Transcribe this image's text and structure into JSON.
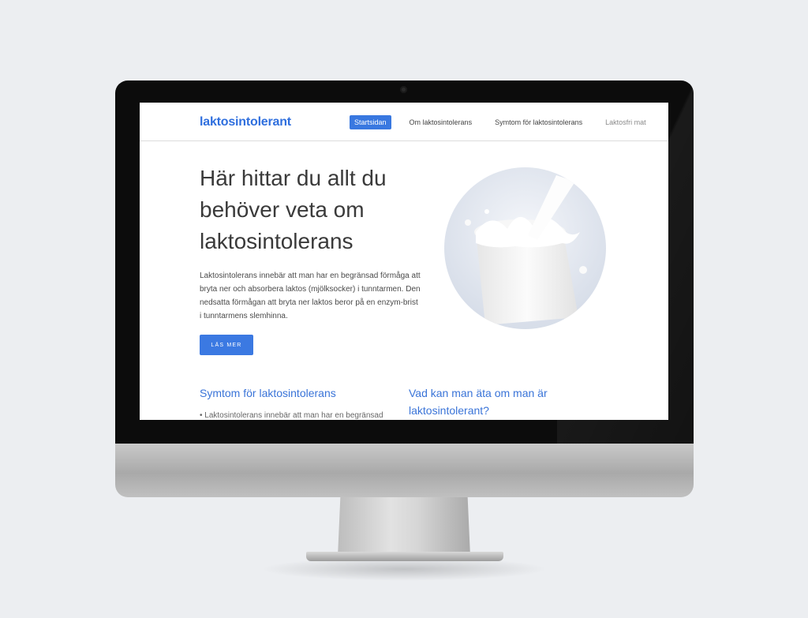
{
  "site": {
    "logo": "laktosintolerant"
  },
  "nav": [
    {
      "label": "Startsidan",
      "active": true
    },
    {
      "label": "Om laktosintolerans"
    },
    {
      "label": "Symtom för laktosintolerans"
    },
    {
      "label": "Laktosfri mat"
    }
  ],
  "hero": {
    "title": "Här hittar du allt du behöver veta om laktosintolerans",
    "text": "Laktosintolerans innebär att man har en begränsad förmåga att bryta ner och absorbera laktos (mjölksocker) i tunntarmen. Den nedsatta förmågan att bryta ner laktos beror på en enzym-brist i tunntarmens slemhinna.",
    "cta": "LÄS MER"
  },
  "sections": {
    "symptoms_title": "Symtom för laktosintolerans",
    "symptoms_bullet": "• Laktosintolerans innebär att man har en begränsad",
    "food_title": "Vad kan man äta om man är laktosintolerant?"
  },
  "colors": {
    "accent": "#3978e0",
    "background": "#eceef1"
  }
}
